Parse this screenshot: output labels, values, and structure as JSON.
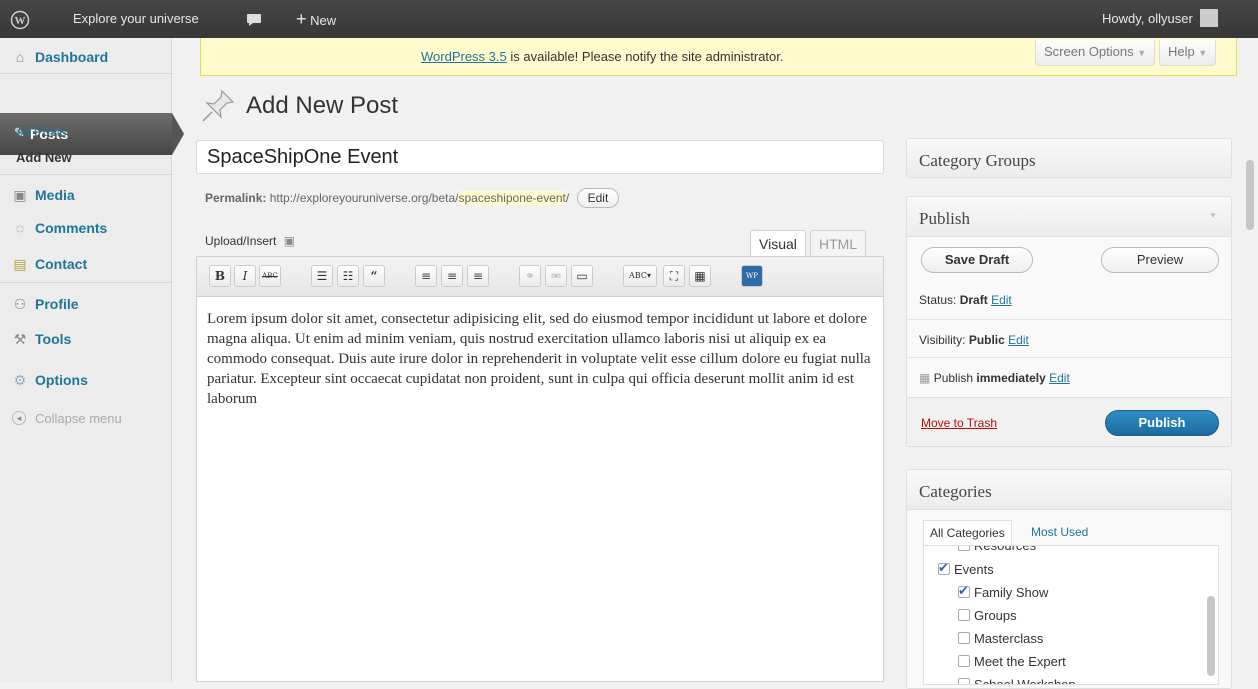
{
  "admin_bar": {
    "site_name": "Explore your universe",
    "new_label": "New",
    "howdy": "Howdy, ollyuser"
  },
  "sidebar": {
    "items": [
      {
        "label": "Dashboard",
        "icon": "home-icon"
      },
      {
        "label": "Posts",
        "icon": "pin-icon"
      },
      {
        "label": "Media",
        "icon": "media-icon"
      },
      {
        "label": "Comments",
        "icon": "comment-icon"
      },
      {
        "label": "Contact",
        "icon": "contact-icon"
      },
      {
        "label": "Profile",
        "icon": "profile-icon"
      },
      {
        "label": "Tools",
        "icon": "tools-icon"
      },
      {
        "label": "Options",
        "icon": "options-icon"
      },
      {
        "label": "Collapse menu",
        "icon": "collapse-icon"
      }
    ],
    "submenu": [
      {
        "label": "All Posts"
      },
      {
        "label": "Add New"
      }
    ]
  },
  "notice": {
    "link_text": "WordPress 3.5",
    "text": " is available! Please notify the site administrator."
  },
  "screen_options": "Screen Options",
  "help": "Help",
  "page": {
    "title": "Add New Post"
  },
  "post": {
    "title": "SpaceShipOne Event",
    "permalink_label": "Permalink:",
    "permalink_base": "http://exploreyouruniverse.org/beta/",
    "permalink_slug": "spaceshipone-event",
    "permalink_end": "/",
    "edit_label": "Edit",
    "upload_insert": "Upload/Insert",
    "tab_visual": "Visual",
    "tab_html": "HTML",
    "content": "Lorem ipsum dolor sit amet, consectetur adipisicing elit, sed do eiusmod tempor incididunt ut labore et dolore magna aliqua. Ut enim ad minim veniam, quis nostrud exercitation ullamco laboris nisi ut aliquip ex ea commodo consequat. Duis aute irure dolor in reprehenderit in voluptate velit esse cillum dolore eu fugiat nulla pariatur. Excepteur sint occaecat cupidatat non proident, sunt in culpa qui officia deserunt mollit anim id est laborum"
  },
  "category_groups": {
    "title": "Category Groups"
  },
  "publish": {
    "title": "Publish",
    "save_draft": "Save Draft",
    "preview": "Preview",
    "status_label": "Status:",
    "status_value": "Draft",
    "visibility_label": "Visibility:",
    "visibility_value": "Public",
    "publish_label": "Publish",
    "publish_value": "immediately",
    "edit": "Edit",
    "trash": "Move to Trash",
    "publish_button": "Publish"
  },
  "categories": {
    "title": "Categories",
    "tab_all": "All Categories",
    "tab_used": "Most Used",
    "items": [
      {
        "label": "Resources",
        "checked": false,
        "level": 1
      },
      {
        "label": "Events",
        "checked": true,
        "level": 0
      },
      {
        "label": "Family Show",
        "checked": true,
        "level": 1
      },
      {
        "label": "Groups",
        "checked": false,
        "level": 1
      },
      {
        "label": "Masterclass",
        "checked": false,
        "level": 1
      },
      {
        "label": "Meet the Expert",
        "checked": false,
        "level": 1
      },
      {
        "label": "School Workshop",
        "checked": false,
        "level": 1
      }
    ]
  },
  "colors": {
    "link": "#21759b",
    "publish_button": "#21759b",
    "notice_bg": "#fffbcc"
  }
}
